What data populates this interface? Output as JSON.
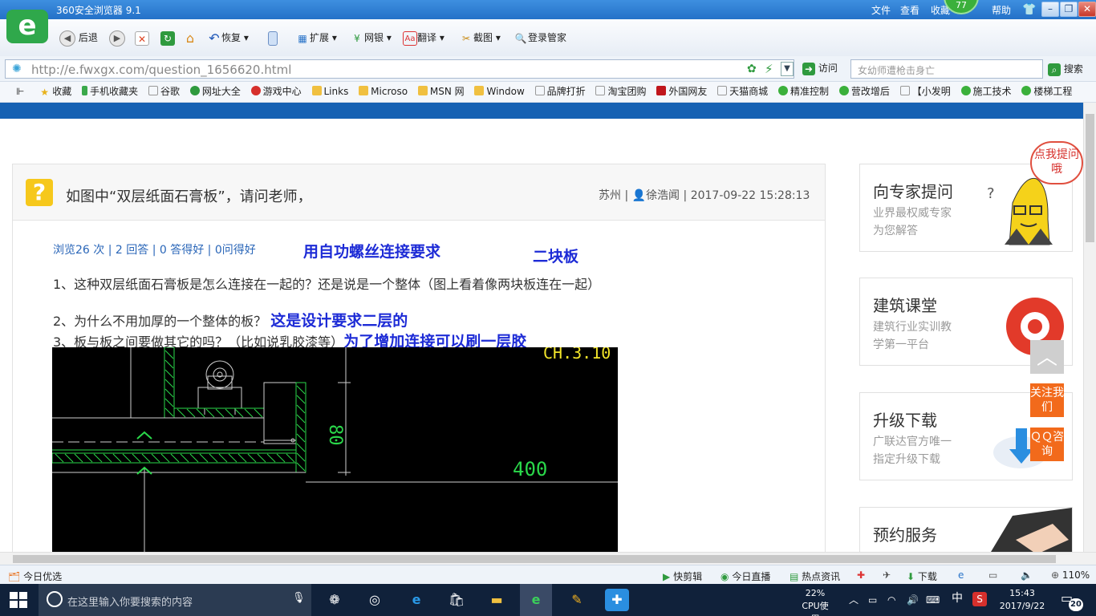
{
  "window": {
    "title": "360安全浏览器 9.1",
    "badge": "77"
  },
  "menu": [
    "文件",
    "查看",
    "收藏",
    "帮助"
  ],
  "toolbar": {
    "back": "后退",
    "restore": "恢复",
    "expand": "扩展",
    "netbank": "网银",
    "translate": "翻译",
    "screenshot": "截图",
    "login": "登录管家"
  },
  "address": {
    "url": "http://e.fwxgx.com/question_1656620.html",
    "visit": "访问",
    "search_placeholder": "女幼师遭枪击身亡",
    "search_button": "搜索"
  },
  "bookmarks": [
    "收藏",
    "手机收藏夹",
    "谷歌",
    "网址大全",
    "游戏中心",
    "Links",
    "Microso",
    "MSN 网",
    "Window",
    "品牌打折",
    "淘宝团购",
    "外国网友",
    "天猫商城",
    "精准控制",
    "营改增后",
    "【小发明",
    "施工技术",
    "楼梯工程"
  ],
  "question": {
    "title": "如图中“双层纸面石膏板”，请问老师，",
    "location": "苏州",
    "user": "徐浩闻",
    "time": "2017-09-22 15:28:13",
    "stats": "浏览26 次 | 2 回答 | 0 答得好 | 0问得好",
    "note_screw": "用自功螺丝连接要求",
    "note_two": "二块板",
    "line1": "1、这种双层纸面石膏板是怎么连接在一起的？还是说是一个整体（图上看着像两块板连在一起）",
    "line2": "2、为什么不用加厚的一个整体的板？",
    "note2": "这是设计要求二层的",
    "line3": "3、板与板之间要做其它的吗？（比如说乳胶漆等）",
    "note3": "为了增加连接可以刷一层胶",
    "cad_dim_80": "80",
    "cad_dim_400": "400",
    "cad_top": "CH.3.10"
  },
  "sidebar": {
    "bubble": "点我提问哦",
    "ask": {
      "title": "向专家提问",
      "sub1": "业界最权威专家",
      "sub2": "为您解答"
    },
    "class": {
      "title": "建筑课堂",
      "sub1": "建筑行业实训教",
      "sub2": "学第一平台"
    },
    "upgrade": {
      "title": "升级下载",
      "sub1": "广联达官方唯一",
      "sub2": "指定升级下载"
    },
    "book": {
      "title": "预约服务"
    },
    "follow": "关注我们",
    "qq": "ＱＱ咨询"
  },
  "statusbar": {
    "today": "今日优选",
    "clip": "快剪辑",
    "live": "今日直播",
    "hot": "热点资讯",
    "download": "下载",
    "zoom": "110%"
  },
  "taskbar": {
    "search": "在这里输入你要搜索的内容",
    "cpu_pct": "22%",
    "cpu_label": "CPU使用",
    "ime": "中",
    "time": "15:43",
    "date": "2017/9/22",
    "notify": "20"
  }
}
